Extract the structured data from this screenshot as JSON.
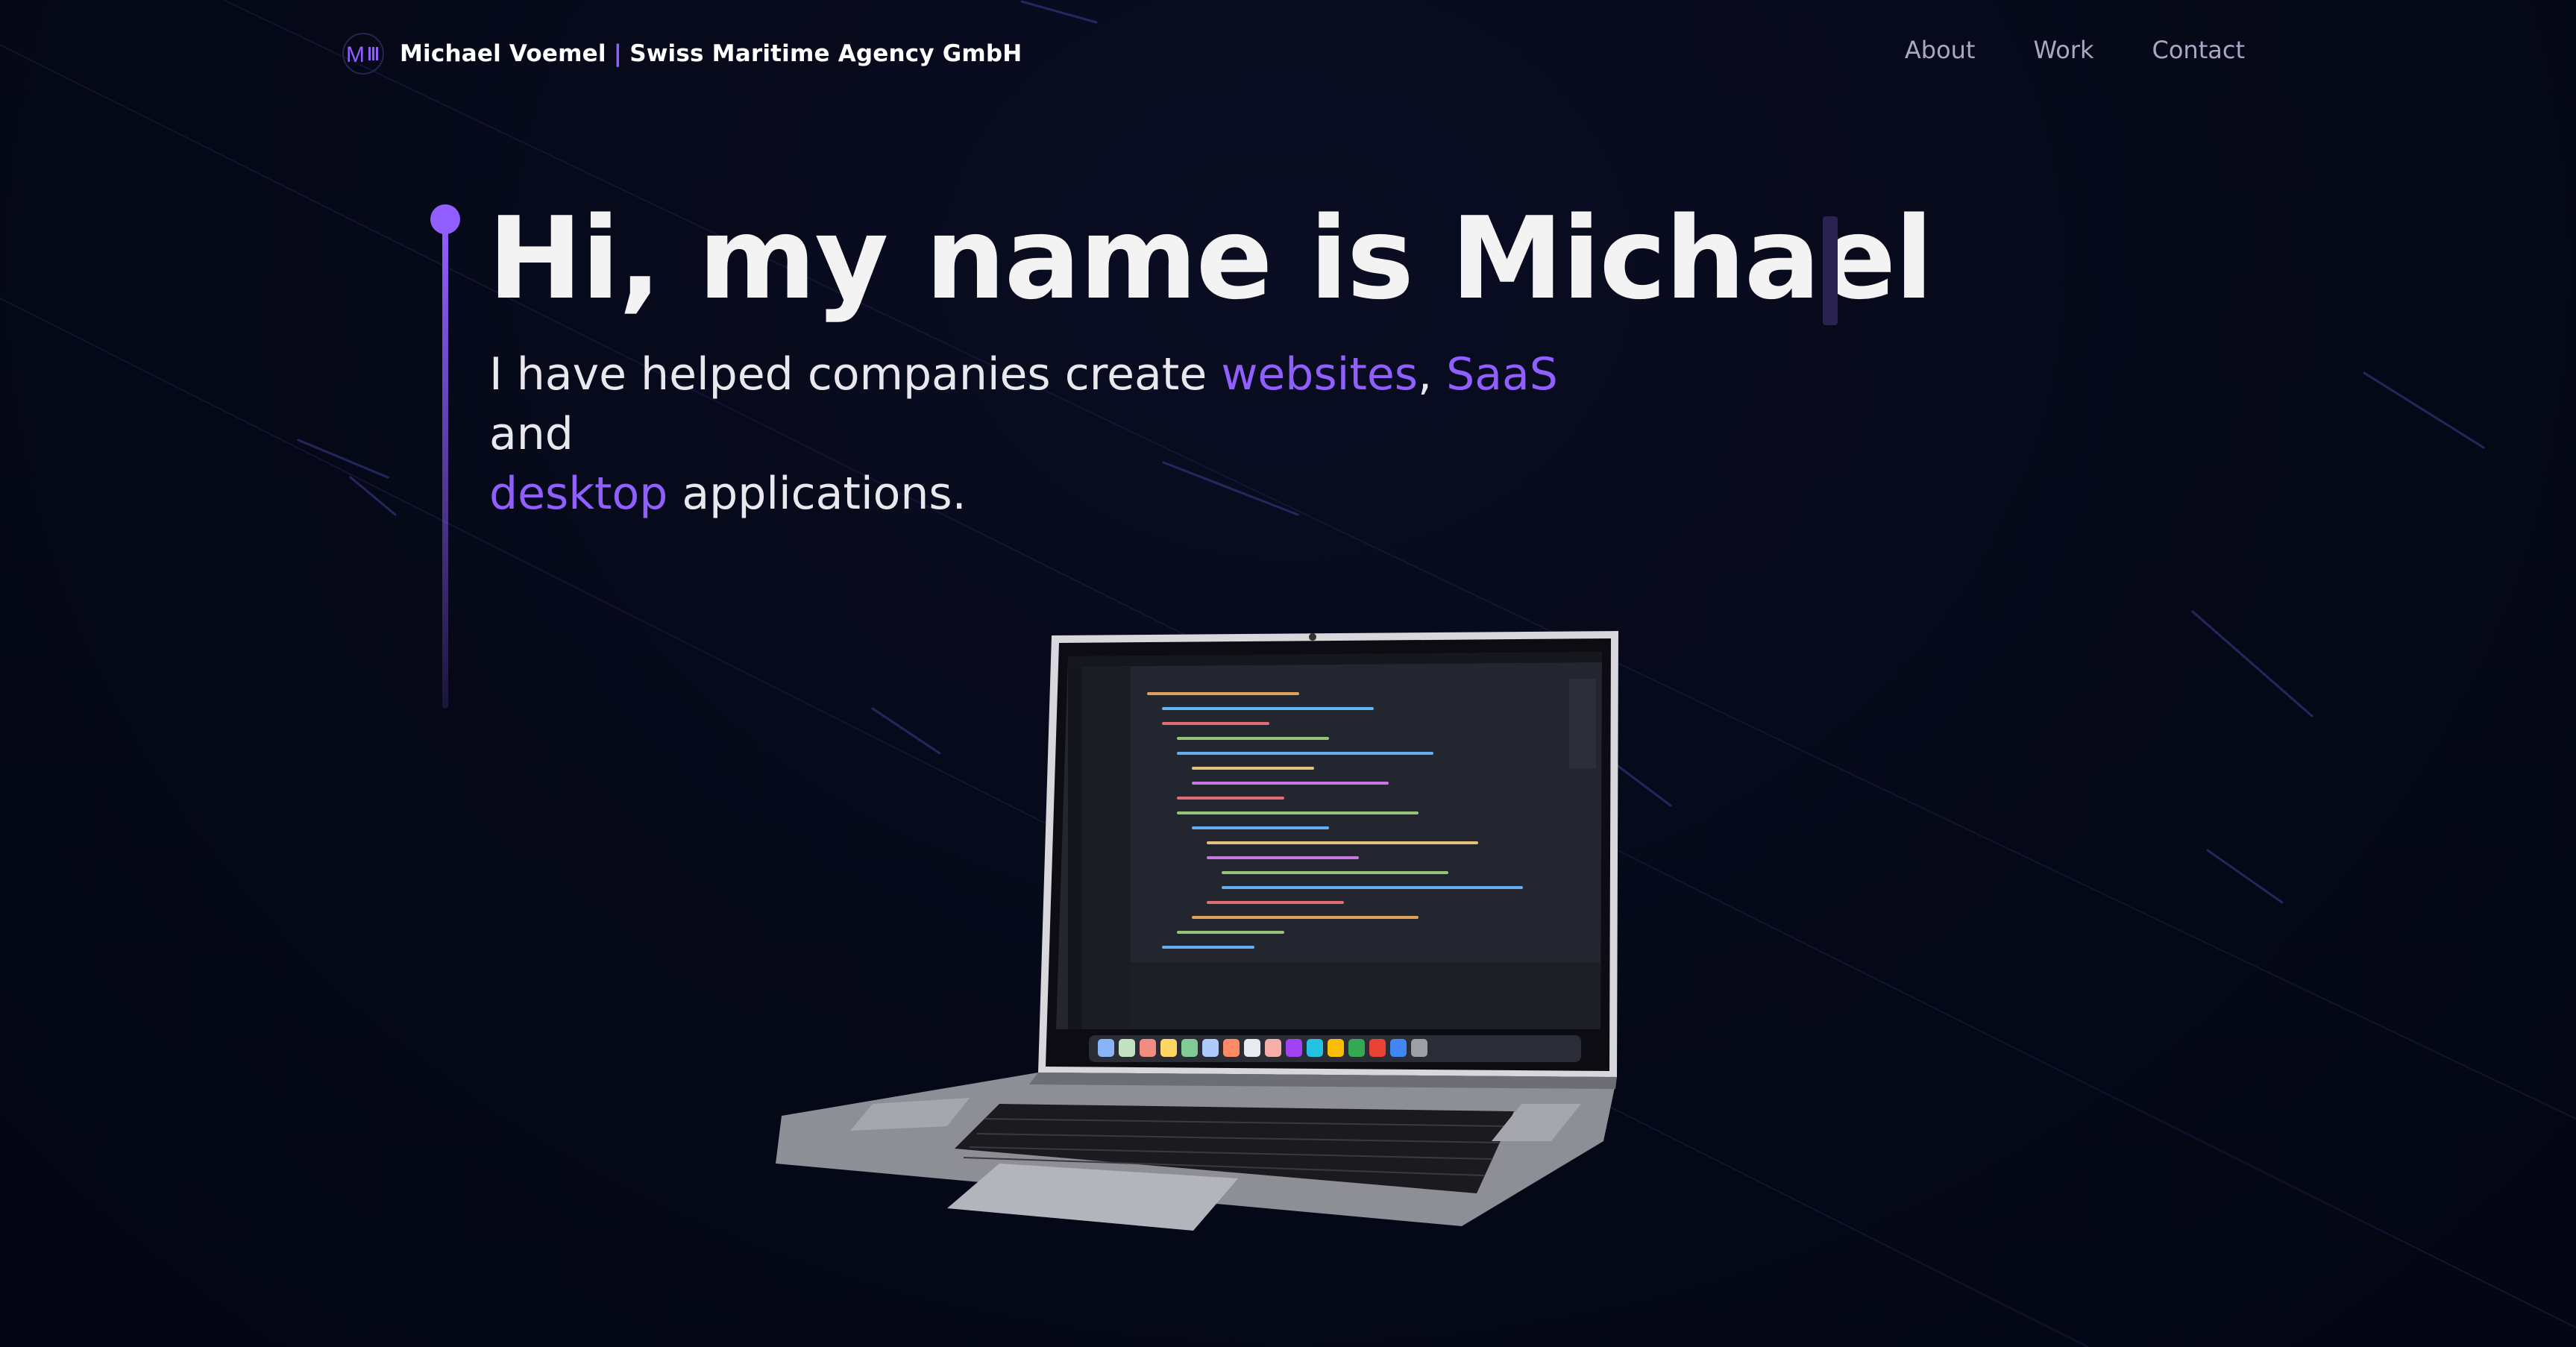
{
  "nav": {
    "brand_name": "Michael Voemel",
    "brand_separator": "|",
    "brand_company": "Swiss Maritime Agency GmbH",
    "brand_logo_icon": "m-monogram-logo",
    "links": [
      {
        "label": "About"
      },
      {
        "label": "Work"
      },
      {
        "label": "Contact"
      }
    ]
  },
  "hero": {
    "title": "Hi, my name is Michael",
    "subtitle": {
      "part1": "I have helped companies create ",
      "accent1": "websites",
      "part2": ", ",
      "accent2": "SaaS",
      "part3": " and",
      "accent3": "desktop",
      "part4": " applications."
    }
  },
  "colors": {
    "background": "#050816",
    "accent": "#915eff",
    "nav_link": "#aaa6c3",
    "title": "#f3f3f3"
  },
  "illustration": {
    "icon": "3d-laptop-code-editor-icon"
  }
}
